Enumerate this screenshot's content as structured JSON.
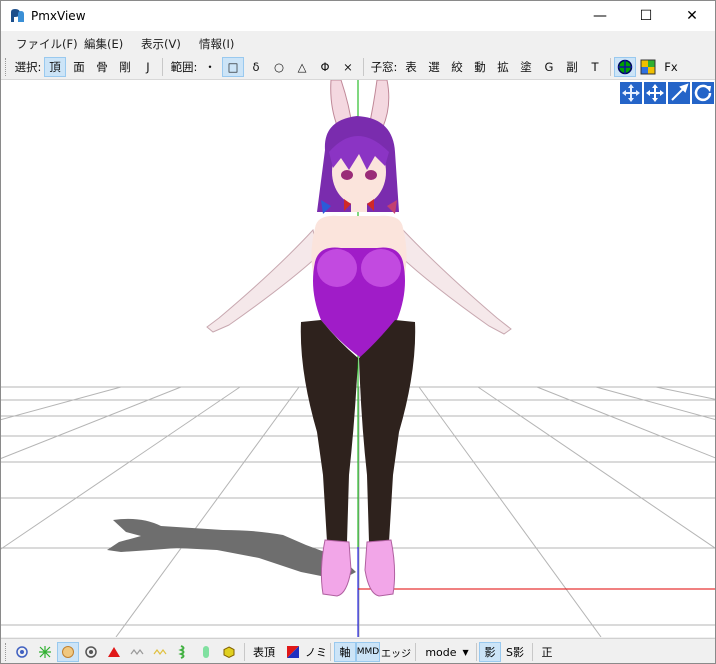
{
  "window": {
    "title": "PmxView"
  },
  "titlebar": {
    "minimize": "—",
    "maximize": "☐",
    "close": "✕"
  },
  "menu": [
    {
      "label": "ファイル(F)"
    },
    {
      "label": "編集(E)"
    },
    {
      "label": "表示(V)"
    },
    {
      "label": "情報(I)"
    }
  ],
  "toolbar": {
    "select_label": "選択:",
    "select_items": [
      "頂",
      "面",
      "骨",
      "剛",
      "J"
    ],
    "range_label": "範囲:",
    "range_items": [
      "・",
      "□",
      "δ",
      "○",
      "△",
      "Φ",
      "×"
    ],
    "child_label": "子窓:",
    "child_items": [
      "表",
      "選",
      "絞",
      "動",
      "拡",
      "塗",
      "G",
      "副",
      "T"
    ],
    "fx_label": "Fx"
  },
  "status": {
    "hyouchou": "表頂",
    "nomi": "ノミ",
    "jiku": "軸",
    "mmd": "MMD",
    "edge": "エッジ",
    "mode": "mode",
    "kage": "影",
    "skage": "S影",
    "sei": "正"
  },
  "colors": {
    "grid": "#b5b5b5",
    "axis_x": "#e00000",
    "axis_y": "#00b000",
    "axis_z": "#0000e0",
    "selected_bg": "#cce4f7"
  }
}
